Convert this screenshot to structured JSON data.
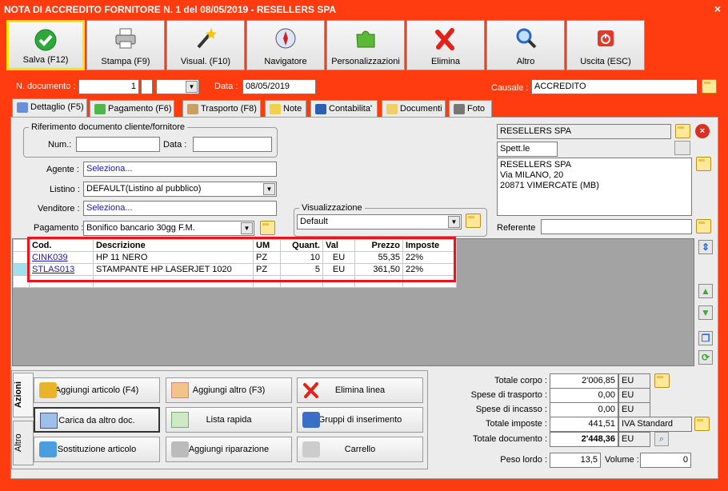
{
  "window": {
    "title": "NOTA DI ACCREDITO FORNITORE N. 1 del 08/05/2019 - RESELLERS SPA",
    "close": "×"
  },
  "toolbar": [
    {
      "label": "Salva (F12)",
      "icon": "check-icon"
    },
    {
      "label": "Stampa (F9)",
      "icon": "printer-icon"
    },
    {
      "label": "Visual. (F10)",
      "icon": "magic-wand-icon"
    },
    {
      "label": "Navigatore",
      "icon": "compass-icon"
    },
    {
      "label": "Personalizzazioni",
      "icon": "puzzle-icon"
    },
    {
      "label": "Elimina",
      "icon": "delete-x-icon"
    },
    {
      "label": "Altro",
      "icon": "magnifier-icon"
    },
    {
      "label": "Uscita (ESC)",
      "icon": "power-icon"
    }
  ],
  "header": {
    "ndoc_label": "N. documento :",
    "ndoc_value": "1",
    "data_label": "Data :",
    "data_value": "08/05/2019",
    "causale_label": "Causale :",
    "causale_value": "ACCREDITO"
  },
  "tabs": [
    {
      "label": "Dettaglio (F5)"
    },
    {
      "label": "Pagamento (F6)"
    },
    {
      "label": "Trasporto (F8)"
    },
    {
      "label": "Note"
    },
    {
      "label": "Contabilita'"
    },
    {
      "label": "Documenti"
    },
    {
      "label": "Foto"
    }
  ],
  "riferimento": {
    "title": "Riferimento documento cliente/fornitore",
    "num_label": "Num.:",
    "data_label": "Data :"
  },
  "fields": {
    "agente_label": "Agente :",
    "agente_value": "Seleziona...",
    "listino_label": "Listino :",
    "listino_value": "DEFAULT(Listino al pubblico)",
    "venditore_label": "Venditore :",
    "venditore_value": "Seleziona...",
    "pagamento_label": "Pagamento :",
    "pagamento_value": "Bonifico bancario 30gg F.M."
  },
  "visualizzazione": {
    "title": "Visualizzazione",
    "value": "Default"
  },
  "cliente": {
    "name": "RESELLERS SPA",
    "salutation": "Spett.le",
    "address_lines": [
      "RESELLERS SPA",
      "Via MILANO, 20",
      "20871 VIMERCATE (MB)"
    ],
    "referente_label": "Referente"
  },
  "grid": {
    "columns": [
      "Cod.",
      "Descrizione",
      "UM",
      "Quant.",
      "Val",
      "Prezzo",
      "Imposte"
    ],
    "rows": [
      {
        "cod": "CINK039",
        "descr": "HP 11 NERO",
        "um": "PZ",
        "quant": "10",
        "val": "EU",
        "prezzo": "55,35",
        "imposte": "22%"
      },
      {
        "cod": "STLAS013",
        "descr": "STAMPANTE HP LASERJET 1020",
        "um": "PZ",
        "quant": "5",
        "val": "EU",
        "prezzo": "361,50",
        "imposte": "22%"
      }
    ]
  },
  "azioni": {
    "tab_azioni": "Azioni",
    "tab_altro": "Altro",
    "buttons": [
      "Aggiungi articolo (F4)",
      "Aggiungi altro (F3)",
      "Elimina linea",
      "Carica da altro doc.",
      "Lista rapida",
      "Gruppi di inserimento",
      "Sostituzione articolo",
      "Aggiungi riparazione",
      "Carrello"
    ]
  },
  "totali": {
    "corpo_label": "Totale corpo :",
    "corpo_value": "2'006,85",
    "corpo_cur": "EU",
    "trasporto_label": "Spese di trasporto :",
    "trasporto_value": "0,00",
    "trasporto_cur": "EU",
    "incasso_label": "Spese di incasso :",
    "incasso_value": "0,00",
    "incasso_cur": "EU",
    "imposte_label": "Totale imposte :",
    "imposte_value": "441,51",
    "imposte_note": "IVA Standard",
    "documento_label": "Totale documento :",
    "documento_value": "2'448,36",
    "documento_cur": "EU",
    "peso_label": "Peso lordo :",
    "peso_value": "13,5",
    "volume_label": "Volume :",
    "volume_value": "0"
  }
}
